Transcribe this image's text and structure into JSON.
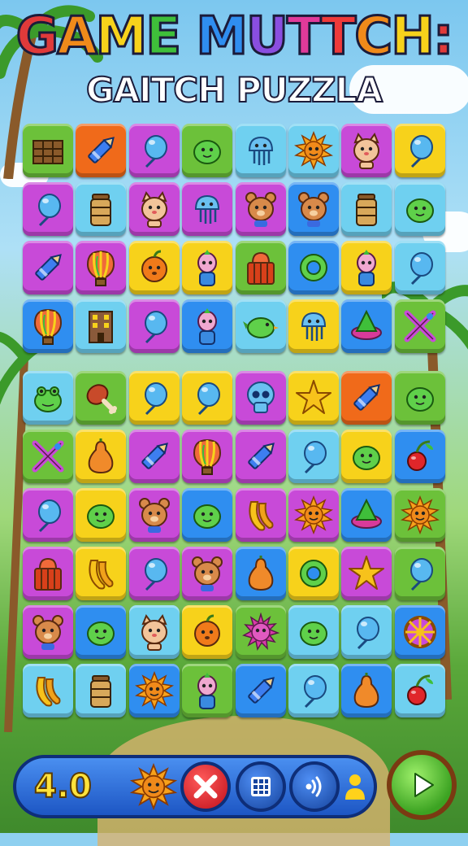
{
  "title": {
    "line1": [
      "G",
      "A",
      "M",
      "E",
      " ",
      "M",
      "U",
      "T",
      "T",
      "C",
      "H",
      ":"
    ],
    "line2": "GAITCH PUZZLA"
  },
  "title_colors": [
    "#e03a3a",
    "#f08a1a",
    "#f7d21b",
    "#3fbf3a",
    "#ffffff",
    "#2f8ef0",
    "#8a4ee0",
    "#e03a9a",
    "#ef3a3a",
    "#f08a1a",
    "#f7d21b",
    "#e03a3a"
  ],
  "board_top": [
    [
      "#6cc13a",
      "crate-icon"
    ],
    [
      "#f06a1a",
      "crayon-icon"
    ],
    [
      "#c84ad8",
      "balloon-icon"
    ],
    [
      "#6cc13a",
      "blob-icon"
    ],
    [
      "#6fd0f0",
      "jellyfish-icon"
    ],
    [
      "#6fd0f0",
      "sun-icon"
    ],
    [
      "#c84ad8",
      "cat-icon"
    ],
    [
      "#f7d21b",
      "balloon-icon"
    ],
    [
      "#c84ad8",
      "balloon-icon"
    ],
    [
      "#6fd0f0",
      "jar-icon"
    ],
    [
      "#c84ad8",
      "cat-icon"
    ],
    [
      "#c84ad8",
      "jellyfish-icon"
    ],
    [
      "#c84ad8",
      "bear-icon"
    ],
    [
      "#2f8ef0",
      "bear-icon"
    ],
    [
      "#6fd0f0",
      "jar-icon"
    ],
    [
      "#6fd0f0",
      "blob-icon"
    ],
    [
      "#c84ad8",
      "crayon-icon"
    ],
    [
      "#c84ad8",
      "hot-air-balloon-icon"
    ],
    [
      "#f7d21b",
      "fruit-icon"
    ],
    [
      "#f7d21b",
      "doll-icon"
    ],
    [
      "#6cc13a",
      "basket-icon"
    ],
    [
      "#2f8ef0",
      "ring-icon"
    ],
    [
      "#f7d21b",
      "doll-icon"
    ],
    [
      "#6fd0f0",
      "balloon-icon"
    ],
    [
      "#2f8ef0",
      "hot-air-balloon-icon"
    ],
    [
      "#6fd0f0",
      "building-icon"
    ],
    [
      "#c84ad8",
      "balloon-icon"
    ],
    [
      "#2f8ef0",
      "doll-icon"
    ],
    [
      "#6fd0f0",
      "bird-icon"
    ],
    [
      "#f7d21b",
      "jellyfish-icon"
    ],
    [
      "#2f8ef0",
      "spinning-top-icon"
    ],
    [
      "#6cc13a",
      "crossed-swords-icon"
    ]
  ],
  "board_bottom": [
    [
      "#6fd0f0",
      "frog-icon"
    ],
    [
      "#6cc13a",
      "drumstick-icon"
    ],
    [
      "#f7d21b",
      "balloon-icon"
    ],
    [
      "#f7d21b",
      "balloon-icon"
    ],
    [
      "#c84ad8",
      "skull-icon"
    ],
    [
      "#f7d21b",
      "star-icon"
    ],
    [
      "#f06a1a",
      "crayon-icon"
    ],
    [
      "#6cc13a",
      "blob-icon"
    ],
    [
      "#6cc13a",
      "crossed-swords-icon"
    ],
    [
      "#f7d21b",
      "pear-icon"
    ],
    [
      "#c84ad8",
      "crayon-icon"
    ],
    [
      "#c84ad8",
      "hot-air-balloon-icon"
    ],
    [
      "#c84ad8",
      "crayon-icon"
    ],
    [
      "#6fd0f0",
      "balloon-icon"
    ],
    [
      "#f7d21b",
      "blob-icon"
    ],
    [
      "#2f8ef0",
      "cherry-icon"
    ],
    [
      "#c84ad8",
      "balloon-icon"
    ],
    [
      "#f7d21b",
      "blob-icon"
    ],
    [
      "#c84ad8",
      "bear-icon"
    ],
    [
      "#2f8ef0",
      "blob-icon"
    ],
    [
      "#c84ad8",
      "banana-icon"
    ],
    [
      "#c84ad8",
      "sun-icon"
    ],
    [
      "#2f8ef0",
      "spinning-top-icon"
    ],
    [
      "#6cc13a",
      "sun-icon"
    ],
    [
      "#c84ad8",
      "basket-icon"
    ],
    [
      "#f7d21b",
      "banana-icon"
    ],
    [
      "#c84ad8",
      "balloon-icon"
    ],
    [
      "#c84ad8",
      "bear-icon"
    ],
    [
      "#2f8ef0",
      "pear-icon"
    ],
    [
      "#f7d21b",
      "ring-icon"
    ],
    [
      "#c84ad8",
      "star-icon"
    ],
    [
      "#6cc13a",
      "balloon-icon"
    ],
    [
      "#c84ad8",
      "bear-icon"
    ],
    [
      "#2f8ef0",
      "blob-icon"
    ],
    [
      "#6fd0f0",
      "cat-icon"
    ],
    [
      "#f7d21b",
      "fruit-icon"
    ],
    [
      "#6cc13a",
      "urchin-icon"
    ],
    [
      "#6fd0f0",
      "blob-icon"
    ],
    [
      "#6fd0f0",
      "balloon-icon"
    ],
    [
      "#2f8ef0",
      "wheel-icon"
    ],
    [
      "#6fd0f0",
      "banana-icon"
    ],
    [
      "#6fd0f0",
      "jar-icon"
    ],
    [
      "#2f8ef0",
      "sun-icon"
    ],
    [
      "#6cc13a",
      "doll-icon"
    ],
    [
      "#2f8ef0",
      "crayon-icon"
    ],
    [
      "#6fd0f0",
      "balloon-icon"
    ],
    [
      "#2f8ef0",
      "pear-icon"
    ],
    [
      "#6fd0f0",
      "cherry-icon"
    ]
  ],
  "bottom_bar": {
    "score": "4.0",
    "buttons": [
      "sun-icon",
      "close-icon",
      "grid-icon",
      "sound-icon",
      "person-icon"
    ],
    "play": "play-icon"
  },
  "colors": {
    "bar": "#2a6fe0",
    "score": "#ffe23b",
    "close": "#e0262a",
    "play": "#3ca322"
  }
}
